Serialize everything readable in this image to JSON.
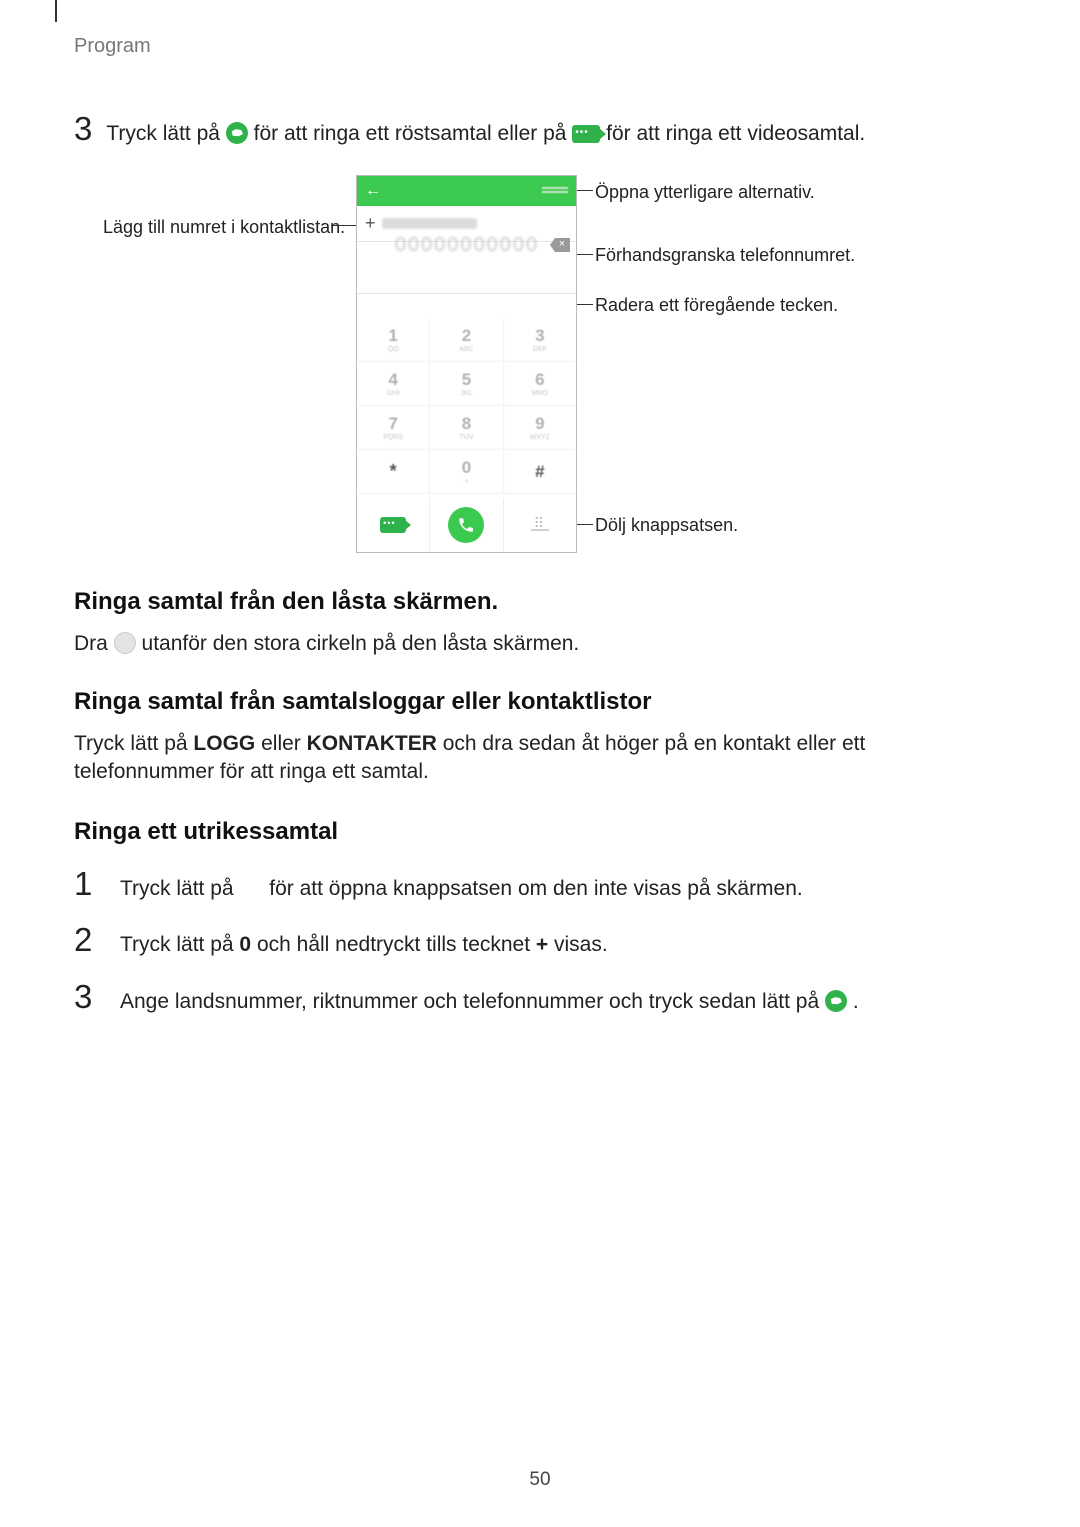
{
  "header": {
    "section": "Program"
  },
  "step3": {
    "num": "3",
    "pre": "Tryck lätt på ",
    "mid": " för att ringa ett röstsamtal eller på ",
    "post": " för att ringa ett videosamtal."
  },
  "callouts": {
    "addContact": "Lägg till numret i kontaktlistan.",
    "moreOptions": "Öppna ytterligare alternativ.",
    "preview": "Förhandsgranska telefonnumret.",
    "deleteChar": "Radera ett föregående tecken.",
    "hideKeypad": "Dölj knappsatsen."
  },
  "phone": {
    "addToContactsIcon": "+",
    "placeholderNumber": "00000000000",
    "keys": [
      [
        "1",
        "QO"
      ],
      [
        "2",
        "ABC"
      ],
      [
        "3",
        "DEF"
      ],
      [
        "4",
        "GHI"
      ],
      [
        "5",
        "JKL"
      ],
      [
        "6",
        "MNO"
      ],
      [
        "7",
        "PQRS"
      ],
      [
        "8",
        "TUV"
      ],
      [
        "9",
        "WXYZ"
      ],
      [
        "*",
        ""
      ],
      [
        "0",
        "+"
      ],
      [
        "#",
        ""
      ]
    ]
  },
  "sec1": {
    "title": "Ringa samtal från den låsta skärmen.",
    "body_pre": "Dra ",
    "body_post": " utanför den stora cirkeln på den låsta skärmen."
  },
  "sec2": {
    "title": "Ringa samtal från samtalsloggar eller kontaktlistor",
    "body_a": "Tryck lätt på ",
    "logg": "LOGG",
    "body_b": " eller ",
    "kontakter": "KONTAKTER",
    "body_c": " och dra sedan åt höger på en kontakt eller ett telefonnummer för att ringa ett samtal."
  },
  "sec3": {
    "title": "Ringa ett utrikessamtal",
    "items": [
      {
        "n": "1",
        "pre": "Tryck lätt på ",
        "post": " för att öppna knappsatsen om den inte visas på skärmen."
      },
      {
        "n": "2",
        "pre": "Tryck lätt på ",
        "bold1": "0",
        "mid": " och håll nedtryckt tills tecknet ",
        "bold2": "+",
        "post": " visas."
      },
      {
        "n": "3",
        "pre": "Ange landsnummer, riktnummer och telefonnummer och tryck sedan lätt på ",
        "post": "."
      }
    ]
  },
  "pageNumber": "50"
}
